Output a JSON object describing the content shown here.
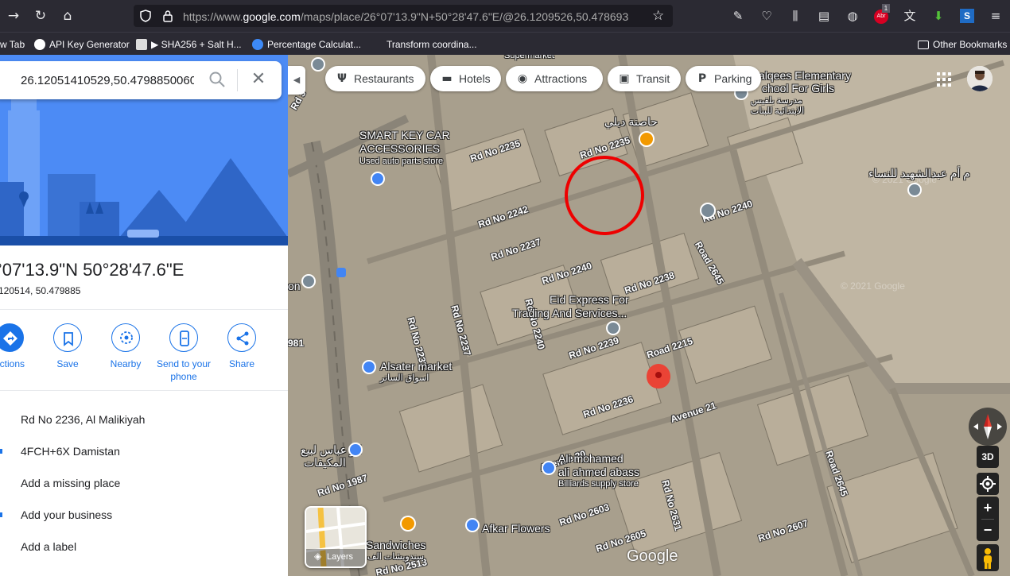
{
  "browser": {
    "url_prefix": "https://www.",
    "url_domain": "google.com",
    "url_rest": "/maps/place/26°07'13.9\"N+50°28'47.6\"E/@26.1209526,50.478693",
    "badge_count": "1",
    "badge_label": "Abr"
  },
  "bookmarks": [
    {
      "label": "w Tab"
    },
    {
      "label": "API Key Generator"
    },
    {
      "label": "▶ SHA256 + Salt H..."
    },
    {
      "label": "Percentage Calculat..."
    },
    {
      "label": "Transform coordina..."
    }
  ],
  "other_bookmarks": "Other Bookmarks",
  "panel": {
    "search_value": "26.12051410529,50.4798850060",
    "title": "°07'13.9\"N 50°28'47.6\"E",
    "subtitle": "120514, 50.479885",
    "actions": [
      {
        "label": "ections"
      },
      {
        "label": "Save"
      },
      {
        "label": "Nearby"
      },
      {
        "label": "Send to your phone"
      },
      {
        "label": "Share"
      }
    ],
    "info_rows": [
      "Rd No 2236, Al Malikiyah",
      "4FCH+6X Damistan",
      "Add a missing place",
      "Add your business",
      "Add a label"
    ]
  },
  "map": {
    "chips": [
      {
        "label": "Restaurants",
        "icon": "fork-knife-icon"
      },
      {
        "label": "Hotels",
        "icon": "bed-icon"
      },
      {
        "label": "Attractions",
        "icon": "camera-icon"
      },
      {
        "label": "Transit",
        "icon": "train-icon"
      },
      {
        "label": "Parking",
        "icon": "parking-icon"
      }
    ],
    "places": {
      "supermarket": "Supermarket",
      "school_en_1": "alqees Elementary",
      "school_en_2": "chool For Girls",
      "school_ar_1": "مدرسة بلقيس",
      "school_ar_2": "الابتدائية للبنات",
      "delhi": "حاصنة دبلي",
      "smartkey_1": "SMART KEY CAR",
      "smartkey_2": "ACCESSORIES",
      "smartkey_sub": "Used auto parts store",
      "women_ar": "م أم عبدالشهيد للنساء",
      "eid_1": "Eid Express For",
      "eid_2": "Trading And Services...",
      "alsater_en": "Alsater market",
      "alsater_ar": "اسواق الساتر",
      "abbas_ar_1": "ابو عباس لبيع",
      "abbas_ar_2": "المكيفات",
      "ali_1": "Ali mohamed",
      "ali_2": "ali ahmed abass",
      "ali_sub": "Billiards supply store",
      "afkar": "Afkar Flowers",
      "sandwiches": "Sandwiches",
      "sandwiches_ar": "سندويشات الف",
      "on_label": "on"
    },
    "roads": [
      "Rd No 2235",
      "Rd No 2235",
      "Rd No 2242",
      "Rd No 2237",
      "Rd No 2240",
      "Rd No 2238",
      "Rd No 2240",
      "Road 2645",
      "Rd No 2233",
      "Rd No 2237",
      "Rd No 2240",
      "Rd No 2239",
      "Road 2215",
      "Rd No 2236",
      "Avenue 21",
      "Avenue 20",
      "Rd No 1987",
      "Rd No 2603",
      "Rd No 2605",
      "Rd No 2631",
      "Rd No 2607",
      "Road 2645",
      "981",
      "Rd No 2513",
      "Rd 3"
    ],
    "watermarks": [
      "© 2021 Google",
      "© 2021 Google"
    ],
    "google_logo": "Google",
    "layers_label": "Layers",
    "btn_3d": "3D",
    "zoom_in": "+",
    "zoom_out": "−"
  }
}
